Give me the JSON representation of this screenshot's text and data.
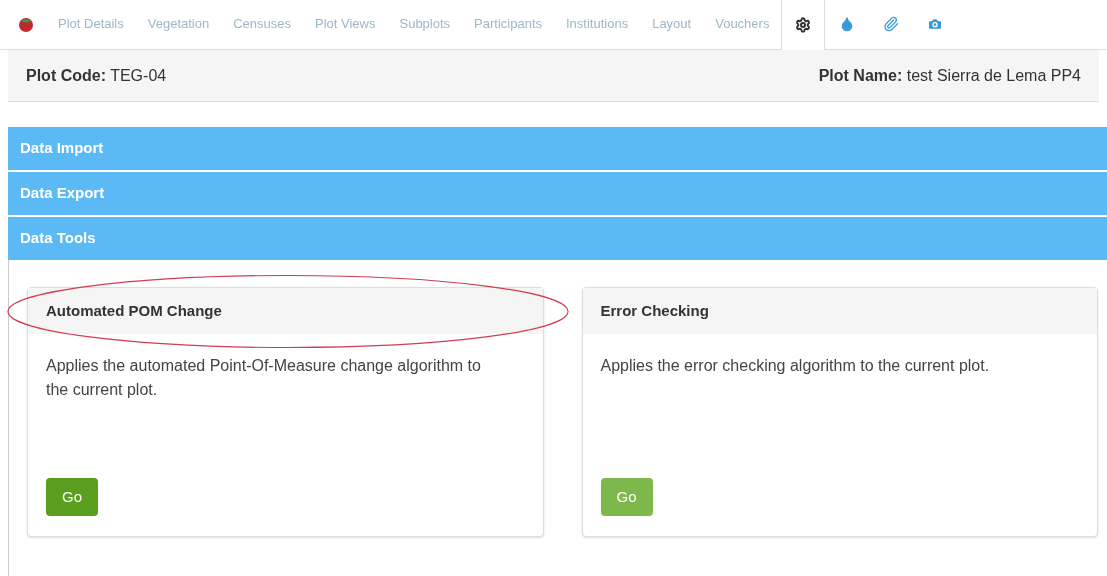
{
  "nav": {
    "tabs": [
      {
        "label": "Plot Details",
        "selected": false
      },
      {
        "label": "Vegetation",
        "selected": false
      },
      {
        "label": "Censuses",
        "selected": false
      },
      {
        "label": "Plot Views",
        "selected": false
      },
      {
        "label": "Subplots",
        "selected": false
      },
      {
        "label": "Participants",
        "selected": false
      },
      {
        "label": "Institutions",
        "selected": false
      },
      {
        "label": "Layout",
        "selected": false
      },
      {
        "label": "Vouchers",
        "selected": false
      }
    ],
    "icon_tabs": [
      {
        "kind": "settings",
        "selected": true
      },
      {
        "kind": "drop",
        "selected": false
      },
      {
        "kind": "attach",
        "selected": false
      },
      {
        "kind": "camera",
        "selected": false
      }
    ]
  },
  "header": {
    "code_label": "Plot Code:",
    "code": "TEG-04",
    "name_label": "Plot Name:",
    "name": "test Sierra de Lema PP4"
  },
  "sections": [
    {
      "title": "Data Import"
    },
    {
      "title": "Data Export"
    },
    {
      "title": "Data Tools"
    }
  ],
  "tools": [
    {
      "title": "Automated POM Change",
      "description": "Applies the automated Point-Of-Measure change algorithm to the current plot.",
      "button": "Go",
      "disabled": false,
      "highlighted": true
    },
    {
      "title": "Error Checking",
      "description": "Applies the error checking algorithm to the current plot.",
      "button": "Go",
      "disabled": true,
      "highlighted": false
    }
  ]
}
